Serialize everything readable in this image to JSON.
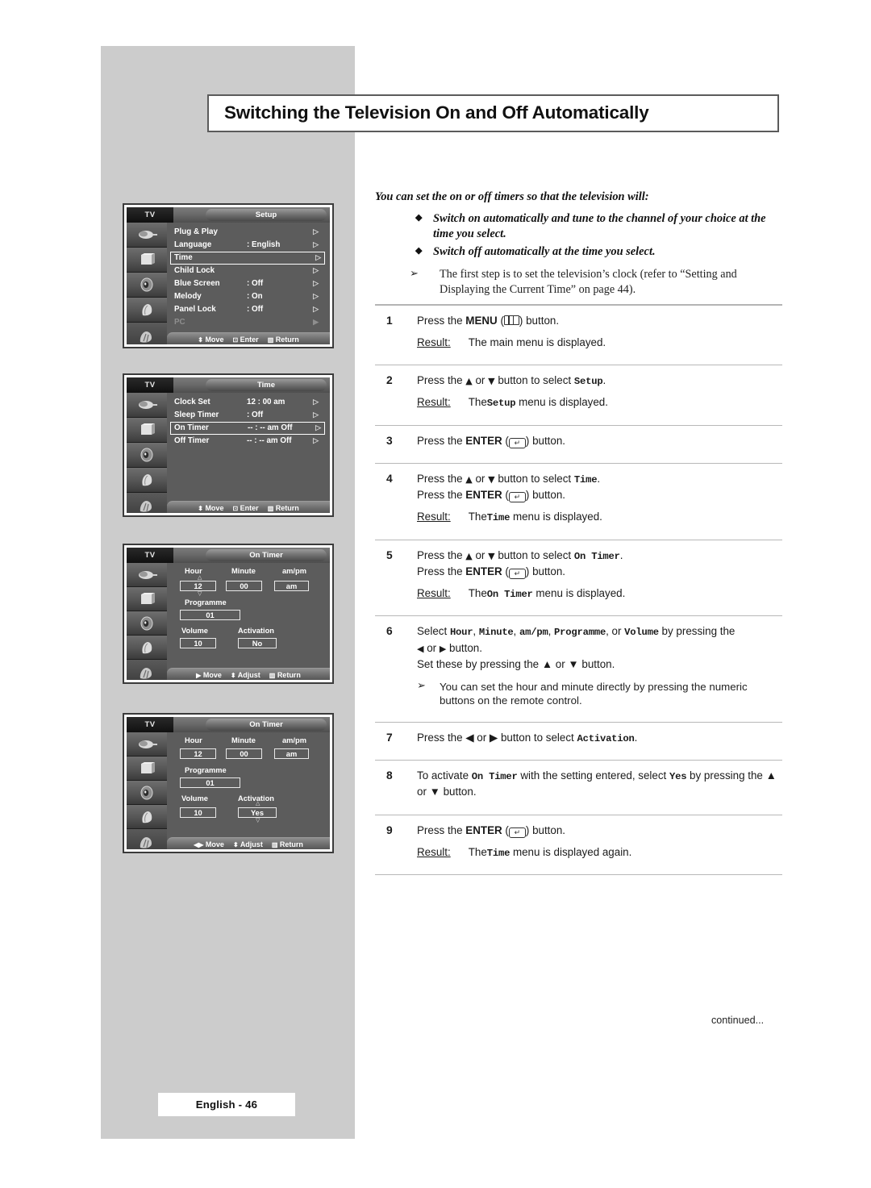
{
  "title": "Switching the Television On and Off Automatically",
  "intro": {
    "lead": "You can set the on or off timers so that the television will:",
    "bullets": [
      "Switch on automatically and tune to the channel of your choice at the time you select.",
      "Switch off automatically at the time you select."
    ],
    "note": "The first step is to set the television’s clock (refer to “Setting and Displaying the Current Time” on page 44)."
  },
  "steps": [
    {
      "num": "1",
      "line1_a": "Press the ",
      "line1_key": "MENU",
      "line1_b": " button.",
      "result_key": "Result:",
      "result_a": "The main menu is displayed.",
      "result_mono": "",
      "result_b": ""
    },
    {
      "num": "2",
      "line1_a": "Press the ",
      "line1_b": " button to select ",
      "line1_mono": "Setup",
      "line1_c": ".",
      "result_key": "Result:",
      "result_a": "The ",
      "result_mono": "Setup",
      "result_b": " menu is displayed."
    },
    {
      "num": "3",
      "line1_a": "Press the ",
      "line1_key": "ENTER",
      "line1_b": " button."
    },
    {
      "num": "4",
      "line1_a": "Press the ",
      "line1_b": " button to select ",
      "line1_mono": "Time",
      "line1_c": ".",
      "line2_a": "Press the ",
      "line2_key": "ENTER",
      "line2_b": " button.",
      "result_key": "Result:",
      "result_a": "The ",
      "result_mono": "Time",
      "result_b": " menu is displayed."
    },
    {
      "num": "5",
      "line1_a": "Press the ",
      "line1_b": " button to select ",
      "line1_mono": "On Timer",
      "line1_c": ".",
      "line2_a": "Press the ",
      "line2_key": "ENTER",
      "line2_b": " button.",
      "result_key": "Result:",
      "result_a": "The ",
      "result_mono": "On Timer",
      "result_b": " menu is displayed."
    },
    {
      "num": "6",
      "sel_a": "Select ",
      "sel_items": [
        "Hour",
        "Minute",
        "am/pm",
        "Programme",
        "Volume"
      ],
      "sel_b": " by pressing the ",
      "sel_c": " button.",
      "line2": "Set these by pressing the ▲ or ▼ button.",
      "subnote": "You can set the hour and minute directly by pressing the numeric buttons on the remote control."
    },
    {
      "num": "7",
      "line1_a": "Press the ◀ or ▶ button to select ",
      "line1_mono": "Activation",
      "line1_c": "."
    },
    {
      "num": "8",
      "line1_a": "To activate ",
      "line1_mono": "On Timer",
      "line1_b": " with the setting entered, select ",
      "line1_mono2": "Yes",
      "line1_c": " by pressing the ▲ or ▼ button."
    },
    {
      "num": "9",
      "line1_a": "Press the ",
      "line1_key": "ENTER",
      "line1_b": " button.",
      "result_key": "Result:",
      "result_a": "The ",
      "result_mono": "Time",
      "result_b": " menu is displayed again."
    }
  ],
  "osd": {
    "tv_label": "TV",
    "footer_move": "Move",
    "footer_enter": "Enter",
    "footer_return": "Return",
    "footer_adjust": "Adjust",
    "setup": {
      "title": "Setup",
      "rows": [
        {
          "label": "Plug & Play",
          "value": "",
          "selected": false,
          "dim": false
        },
        {
          "label": "Language",
          "value": ": English",
          "selected": false,
          "dim": false
        },
        {
          "label": "Time",
          "value": "",
          "selected": true,
          "dim": false
        },
        {
          "label": "Child Lock",
          "value": "",
          "selected": false,
          "dim": false
        },
        {
          "label": "Blue Screen",
          "value": ": Off",
          "selected": false,
          "dim": false
        },
        {
          "label": "Melody",
          "value": ": On",
          "selected": false,
          "dim": false
        },
        {
          "label": "Panel Lock",
          "value": ": Off",
          "selected": false,
          "dim": false
        },
        {
          "label": "PC",
          "value": "",
          "selected": false,
          "dim": true
        }
      ]
    },
    "time": {
      "title": "Time",
      "rows": [
        {
          "label": "Clock Set",
          "value": "12 : 00 am",
          "selected": false,
          "dim": false
        },
        {
          "label": "Sleep Timer",
          "value": ": Off",
          "selected": false,
          "dim": false
        },
        {
          "label": "On Timer",
          "value": "-- : -- am Off",
          "selected": true,
          "dim": false
        },
        {
          "label": "Off Timer",
          "value": "-- : -- am Off",
          "selected": false,
          "dim": false
        }
      ]
    },
    "ontimer_no": {
      "title": "On Timer",
      "labels": {
        "hour": "Hour",
        "minute": "Minute",
        "ampm": "am/pm",
        "programme": "Programme",
        "volume": "Volume",
        "activation": "Activation"
      },
      "values": {
        "hour": "12",
        "minute": "00",
        "ampm": "am",
        "programme": "01",
        "volume": "10",
        "activation": "No"
      },
      "focus": "hour"
    },
    "ontimer_yes": {
      "title": "On Timer",
      "labels": {
        "hour": "Hour",
        "minute": "Minute",
        "ampm": "am/pm",
        "programme": "Programme",
        "volume": "Volume",
        "activation": "Activation"
      },
      "values": {
        "hour": "12",
        "minute": "00",
        "ampm": "am",
        "programme": "01",
        "volume": "10",
        "activation": "Yes"
      },
      "focus": "activation"
    }
  },
  "footer": {
    "continued": "continued...",
    "page_badge": "English - 46"
  }
}
